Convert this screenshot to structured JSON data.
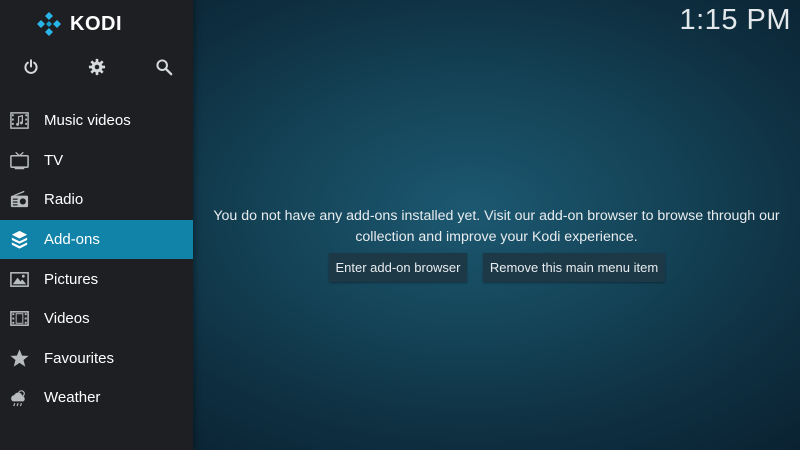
{
  "app": {
    "name": "KODI"
  },
  "clock": {
    "time": "1:15 PM"
  },
  "top_icons": [
    {
      "name": "power-icon"
    },
    {
      "name": "settings-icon"
    },
    {
      "name": "search-icon"
    }
  ],
  "menu": {
    "items": [
      {
        "label": "Music videos",
        "icon": "music-videos-icon",
        "active": false
      },
      {
        "label": "TV",
        "icon": "tv-icon",
        "active": false
      },
      {
        "label": "Radio",
        "icon": "radio-icon",
        "active": false
      },
      {
        "label": "Add-ons",
        "icon": "addons-icon",
        "active": true
      },
      {
        "label": "Pictures",
        "icon": "pictures-icon",
        "active": false
      },
      {
        "label": "Videos",
        "icon": "videos-icon",
        "active": false
      },
      {
        "label": "Favourites",
        "icon": "star-icon",
        "active": false
      },
      {
        "label": "Weather",
        "icon": "weather-icon",
        "active": false
      }
    ]
  },
  "content": {
    "message": "You do not have any add-ons installed yet. Visit our add-on browser to browse through our collection and improve your Kodi experience.",
    "buttons": {
      "browser": "Enter add-on browser",
      "remove": "Remove this main menu item"
    }
  },
  "colors": {
    "accent": "#1183a8",
    "sidebar": "#1e1f22",
    "background": "#154559"
  }
}
